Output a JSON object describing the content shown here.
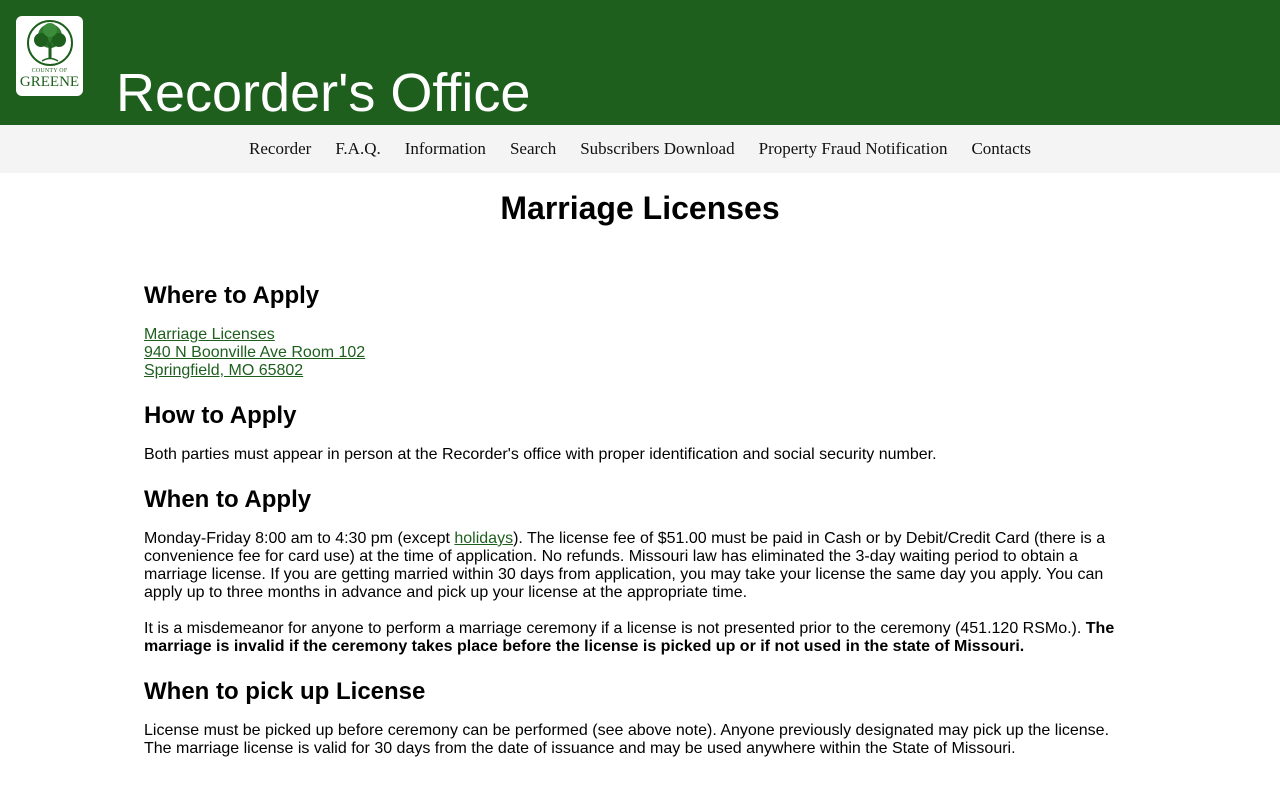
{
  "header": {
    "logo": {
      "county_of": "COUNTY OF",
      "name": "GREENE",
      "icon": "tree-icon"
    },
    "title": "Recorder's Office",
    "brand_color": "#1e5f1e"
  },
  "nav": {
    "items": [
      "Recorder",
      "F.A.Q.",
      "Information",
      "Search",
      "Subscribers Download",
      "Property Fraud Notification",
      "Contacts"
    ]
  },
  "page": {
    "title": "Marriage Licenses"
  },
  "sections": {
    "where": {
      "heading": "Where to Apply",
      "links": [
        "Marriage Licenses",
        "940 N Boonville Ave Room 102",
        "Springfield, MO 65802"
      ]
    },
    "how": {
      "heading": "How to Apply",
      "text": "Both parties must appear in person at the Recorder's office with proper identification and social security number."
    },
    "when": {
      "heading": "When to Apply",
      "p1_before": "Monday-Friday 8:00 am to 4:30 pm (except ",
      "p1_link": "holidays",
      "p1_after": "). The license fee of $51.00 must be paid in Cash or by Debit/Credit Card (there is a convenience fee for card use) at the time of application. No refunds. Missouri law has eliminated the 3-day waiting period to obtain a marriage license. If you are getting married within 30 days from application, you may take your license the same day you apply. You can apply up to three months in advance and pick up your license at the appropriate time.",
      "p2_text": "It is a misdemeanor for anyone to perform a marriage ceremony if a license is not presented prior to the ceremony (451.120 RSMo.). ",
      "p2_bold": "The marriage is invalid if the ceremony takes place before the license is picked up or if not used in the state of Missouri."
    },
    "pickup": {
      "heading": "When to pick up License",
      "text": "License must be picked up before ceremony can be performed (see above note). Anyone previously designated may pick up the license. The marriage license is valid for 30 days from the date of issuance and may be used anywhere within the State of Missouri."
    }
  }
}
